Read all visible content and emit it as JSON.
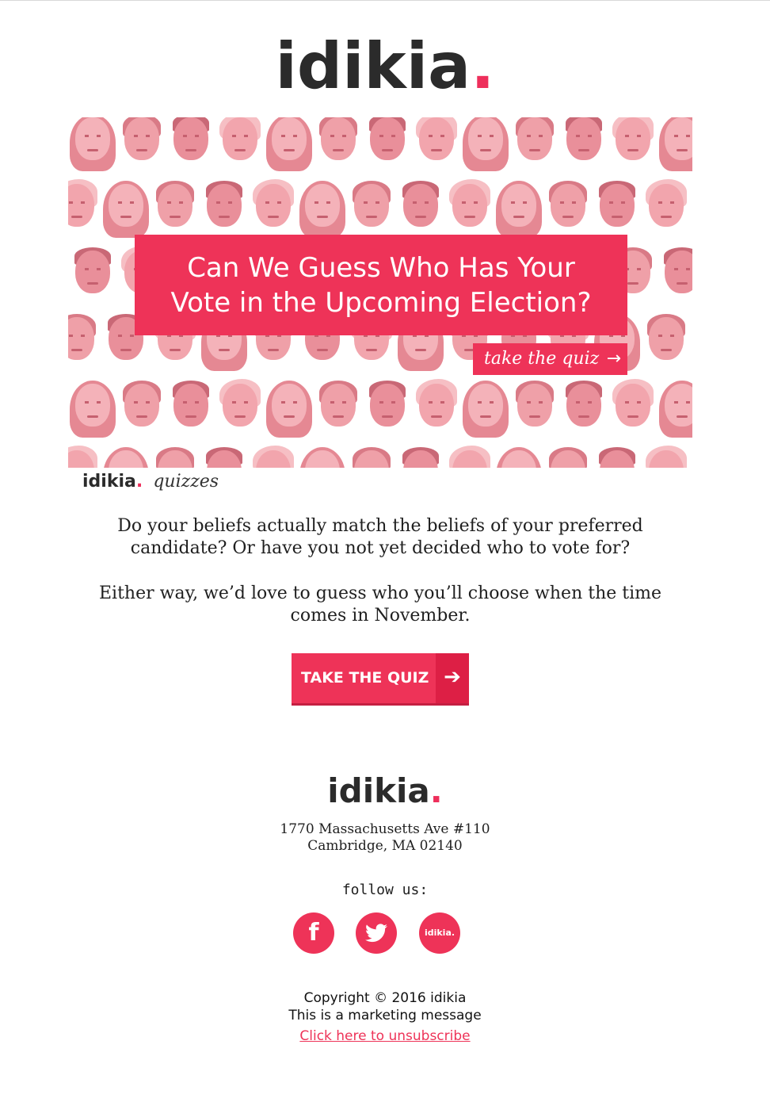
{
  "brand": {
    "name": "idikia",
    "dot": "."
  },
  "hero": {
    "title_line1": "Can We Guess Who Has Your",
    "title_line2": "Vote in the Upcoming Election?",
    "cta_label": "take the quiz",
    "cta_icon": "arrow-right-icon"
  },
  "quizzes": {
    "label": "quizzes"
  },
  "body": {
    "para1_line1": "Do your beliefs actually match the beliefs of your preferred",
    "para1_line2": "candidate?  Or have you not yet decided who to vote for?",
    "para2_line1": "Either way, we’d love to guess who you’ll choose when the time",
    "para2_line2": "comes in November."
  },
  "button": {
    "label": "TAKE THE QUIZ",
    "icon": "arrow-right-icon"
  },
  "footer": {
    "address_line1": "1770 Massachusetts Ave #110",
    "address_line2": "Cambridge, MA 02140",
    "follow_label": "follow us:",
    "social": [
      {
        "name": "facebook-icon",
        "glyph": "f"
      },
      {
        "name": "twitter-icon"
      },
      {
        "name": "idikia-icon",
        "glyph": "idikia."
      }
    ],
    "copyright": "Copyright © 2016 idikia",
    "marketing": "This is a marketing message",
    "unsubscribe": "Click here to unsubscribe"
  },
  "colors": {
    "accent": "#ee3358",
    "logo_text": "#2b2b2b",
    "face_tint": "#f2a5ad"
  }
}
